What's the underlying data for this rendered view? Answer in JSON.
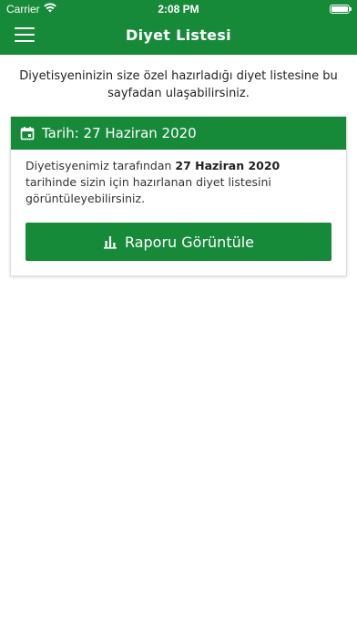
{
  "status_bar": {
    "carrier": "Carrier",
    "time": "2:08 PM"
  },
  "header": {
    "title": "Diyet Listesi"
  },
  "intro_text": "Diyetisyeninizin size özel hazırladığı diyet listesine bu sayfadan ulaşabilirsiniz.",
  "card": {
    "date_label": "Tarih: 27 Haziran 2020",
    "body_prefix": "Diyetisyenimiz tarafından ",
    "body_date": "27 Haziran 2020",
    "body_suffix": " tarihinde sizin için hazırlanan diyet listesini görüntüleyebilirsiniz.",
    "button_label": "Raporu Görüntüle"
  },
  "colors": {
    "primary": "#178a3a"
  },
  "icons": {
    "menu": "hamburger-menu-icon",
    "date": "calendar-icon",
    "report": "bar-chart-icon",
    "wifi": "wifi-icon",
    "battery": "battery-icon"
  }
}
